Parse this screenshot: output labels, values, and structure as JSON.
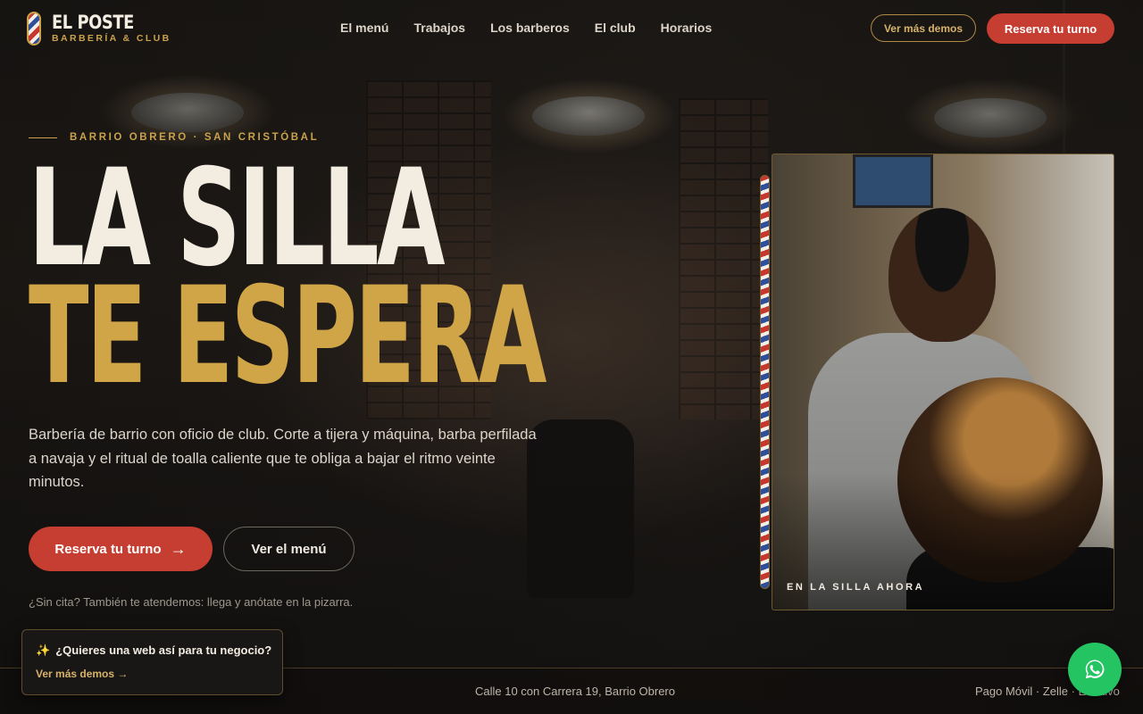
{
  "brand": {
    "name": "EL POSTE",
    "subtitle": "BARBERÍA & CLUB"
  },
  "nav": {
    "items": [
      {
        "label": "El menú"
      },
      {
        "label": "Trabajos"
      },
      {
        "label": "Los barberos"
      },
      {
        "label": "El club"
      },
      {
        "label": "Horarios"
      }
    ]
  },
  "header": {
    "demos_label": "Ver más demos",
    "book_label": "Reserva tu turno"
  },
  "hero": {
    "eyebrow": "BARRIO OBRERO · SAN CRISTÓBAL",
    "title_line1": "LA SILLA",
    "title_line2": "TE ESPERA",
    "description": "Barbería de barrio con oficio de club. Corte a tijera y máquina, barba perfilada a navaja y el ritual de toalla caliente que te obliga a bajar el ritmo veinte minutos.",
    "primary_label": "Reserva tu turno",
    "secondary_label": "Ver el menú",
    "walkin_note": "¿Sin cita? También te atendemos: llega y anótate en la pizarra."
  },
  "photo": {
    "caption": "EN LA SILLA AHORA"
  },
  "footer": {
    "address": "Calle 10 con Carrera 19, Barrio Obrero",
    "payments": "Pago Móvil · Zelle · Efectivo"
  },
  "promo": {
    "title": "¿Quieres una web así para tu negocio?",
    "link_label": "Ver más demos →"
  },
  "icons": {
    "arrow": "→",
    "sparkle": "✨"
  },
  "colors": {
    "accent_red": "#c63d31",
    "accent_gold": "#c9a24b",
    "whatsapp_green": "#25c462"
  }
}
